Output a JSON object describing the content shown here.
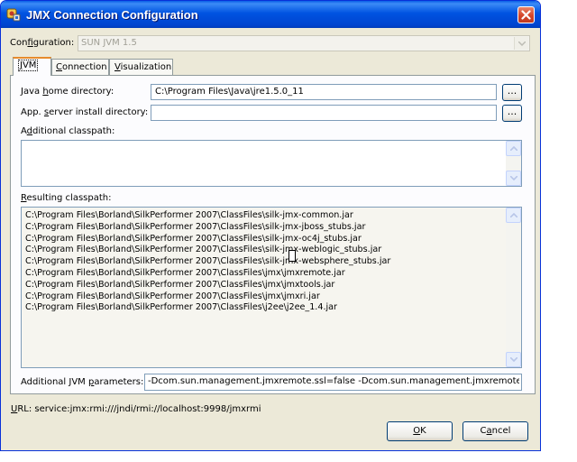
{
  "window": {
    "title": "JMX Connection Configuration"
  },
  "configuration": {
    "label_pre": "Con",
    "label_key": "f",
    "label_post": "iguration:",
    "value": "SUN JVM 1.5"
  },
  "tabs": [
    {
      "pre": "",
      "key": "J",
      "post": "VM"
    },
    {
      "pre": "",
      "key": "C",
      "post": "onnection"
    },
    {
      "pre": "",
      "key": "V",
      "post": "isualization"
    }
  ],
  "jvm": {
    "java_home": {
      "pre": "Java ",
      "key": "h",
      "post": "ome directory:",
      "value": "C:\\Program Files\\Java\\jre1.5.0_11"
    },
    "app_server": {
      "pre": "App. ",
      "key": "s",
      "post": "erver install directory:",
      "value": ""
    },
    "browse_label": "...",
    "additional_classpath": {
      "pre": "A",
      "key": "d",
      "post": "ditional classpath:",
      "value": ""
    },
    "resulting_classpath": {
      "pre": "",
      "key": "R",
      "post": "esulting classpath:",
      "lines": [
        "C:\\Program Files\\Borland\\SilkPerformer 2007\\ClassFiles\\silk-jmx-common.jar",
        "C:\\Program Files\\Borland\\SilkPerformer 2007\\ClassFiles\\silk-jmx-jboss_stubs.jar",
        "C:\\Program Files\\Borland\\SilkPerformer 2007\\ClassFiles\\silk-jmx-oc4j_stubs.jar",
        "C:\\Program Files\\Borland\\SilkPerformer 2007\\ClassFiles\\silk-jmx-weblogic_stubs.jar",
        "C:\\Program Files\\Borland\\SilkPerformer 2007\\ClassFiles\\silk-jmx-websphere_stubs.jar",
        "C:\\Program Files\\Borland\\SilkPerformer 2007\\ClassFiles\\jmx\\jmxremote.jar",
        "C:\\Program Files\\Borland\\SilkPerformer 2007\\ClassFiles\\jmx\\jmxtools.jar",
        "C:\\Program Files\\Borland\\SilkPerformer 2007\\ClassFiles\\jmx\\jmxri.jar",
        "C:\\Program Files\\Borland\\SilkPerformer 2007\\ClassFiles\\j2ee\\j2ee_1.4.jar"
      ]
    },
    "jvm_parameters": {
      "pre": "Additional JVM ",
      "key": "p",
      "post": "arameters:",
      "value": "-Dcom.sun.management.jmxremote.ssl=false -Dcom.sun.management.jmxremote.au"
    }
  },
  "url": {
    "key": "U",
    "post": "RL:",
    "value": "service:jmx:rmi:///jndi/rmi://localhost:9998/jmxrmi"
  },
  "buttons": {
    "ok": {
      "pre": "",
      "key": "O",
      "post": "K"
    },
    "cancel": {
      "pre": "C",
      "key": "a",
      "post": "ncel"
    }
  },
  "colors": {
    "titlebar": "#0054e3",
    "dialog_bg": "#ece9d8",
    "close": "#d4452a",
    "active_tab_accent": "#e68b2c"
  },
  "icons": {
    "app": "app-icon",
    "close": "close-icon"
  }
}
